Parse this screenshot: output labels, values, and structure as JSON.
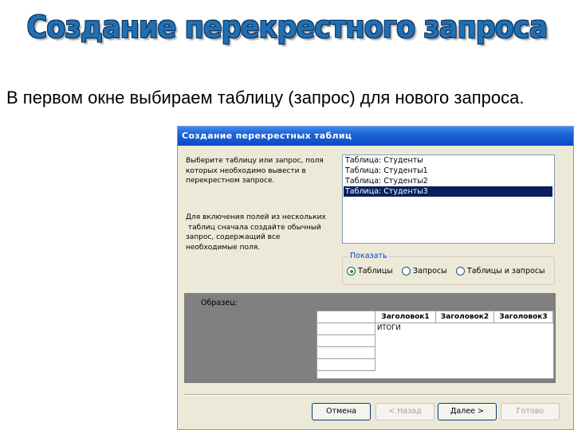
{
  "slide": {
    "title": "Создание перекрестного запроса",
    "text": "В первом окне выбираем таблицу (запрос) для нового запроса."
  },
  "dialog": {
    "title": "Создание перекрестных таблиц",
    "instruction_1": [
      "Выберите таблицу или запрос, поля",
      "которых необходимо вывести в",
      "перекрестном запросе."
    ],
    "instruction_2": [
      "Для включения полей из нескольких",
      " таблиц сначала создайте обычный",
      "запрос, содержащий все",
      "необходимые поля."
    ],
    "list_items": [
      "Таблица: Студенты",
      "Таблица: Студенты1",
      "Таблица: Студенты2",
      "Таблица: Студенты3"
    ],
    "selected_index": 3,
    "show_group": {
      "label": "Показать",
      "options": [
        "Таблицы",
        "Запросы",
        "Таблицы и запросы"
      ],
      "selected": 0
    },
    "sample": {
      "label": "Образец:",
      "headers": [
        "Заголовок1",
        "Заголовок2",
        "Заголовок3"
      ],
      "totals_label": "ИТОГИ"
    },
    "buttons": {
      "cancel": "Отмена",
      "back": "< Назад",
      "next": "Далее >",
      "finish": "Готово"
    }
  },
  "colors": {
    "title_blue": "#1f6fb3",
    "titlebar_blue": "#0a4ac6",
    "dialog_bg": "#ece9d8",
    "selection": "#0a1f5c"
  }
}
